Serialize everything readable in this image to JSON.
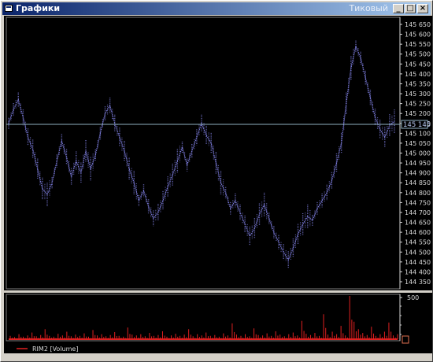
{
  "window": {
    "title": "Графики",
    "mode_label": "Тиковый",
    "controls": [
      "_",
      "□",
      "×"
    ]
  },
  "price_axis": {
    "ticks": [
      "145 650",
      "145 600",
      "145 550",
      "145 500",
      "145 450",
      "145 400",
      "145 350",
      "145 300",
      "145 250",
      "145 200",
      "145 150",
      "145 100",
      "145 050",
      "145 000",
      "144 950",
      "144 900",
      "144 850",
      "144 800",
      "144 750",
      "144 700",
      "144 650",
      "144 600",
      "144 550",
      "144 500",
      "144 450",
      "144 400",
      "144 350"
    ],
    "current_price_label": "145 145"
  },
  "volume_axis": {
    "tick_label": "500"
  },
  "legend": {
    "series_label": "RIM2 [Volume]"
  },
  "colors": {
    "price_series": "#7a7ad8",
    "current_line": "#8fb0c0",
    "volume_bars": "#e02020",
    "axis_text": "#d8d8d8",
    "background": "#000000"
  },
  "chart_data": [
    {
      "type": "line",
      "ylim": [
        144350,
        145650
      ],
      "y_ticks": [
        145650,
        145600,
        145550,
        145500,
        145450,
        145400,
        145350,
        145300,
        145250,
        145200,
        145150,
        145100,
        145050,
        145000,
        144950,
        144900,
        144850,
        144800,
        144750,
        144700,
        144650,
        144600,
        144550,
        144500,
        144450,
        144400,
        144350
      ],
      "reference_line": 145145,
      "series": [
        {
          "values": [
            145150,
            145220,
            145270,
            145180,
            145080,
            145020,
            144920,
            144820,
            144790,
            144850,
            144960,
            145060,
            144980,
            144880,
            144960,
            144900,
            145010,
            144920,
            144990,
            145100,
            145200,
            145240,
            145150,
            145080,
            145010,
            144920,
            144850,
            144760,
            144810,
            144730,
            144670,
            144700,
            144760,
            144830,
            144890,
            144960,
            145030,
            144940,
            145010,
            145080,
            145150,
            145090,
            145050,
            144950,
            144850,
            144800,
            144720,
            144760,
            144700,
            144640,
            144580,
            144620,
            144690,
            144740,
            144670,
            144600,
            144550,
            144500,
            144460,
            144520,
            144590,
            144640,
            144680,
            144660,
            144720,
            144760,
            144800,
            144860,
            144950,
            145050,
            145250,
            145430,
            145540,
            145480,
            145380,
            145280,
            145180,
            145120,
            145080,
            145140,
            145160
          ]
        }
      ]
    },
    {
      "type": "bar",
      "y_ticks": [
        500
      ],
      "series": [
        {
          "name": "RIM2 [Volume]",
          "values": [
            40,
            25,
            60,
            30,
            45,
            80,
            35,
            50,
            120,
            40,
            30,
            65,
            45,
            90,
            35,
            55,
            40,
            70,
            30,
            110,
            45,
            60,
            35,
            50,
            85,
            40,
            30,
            140,
            55,
            45,
            60,
            35,
            75,
            40,
            50,
            95,
            30,
            45,
            65,
            40,
            55,
            120,
            35,
            60,
            45,
            80,
            40,
            50,
            30,
            70,
            45,
            190,
            55,
            40,
            60,
            35,
            130,
            50,
            45,
            70,
            40,
            95,
            55,
            35,
            60,
            80,
            45,
            220,
            65,
            50,
            75,
            40,
            300,
            55,
            90,
            60,
            160,
            45,
            520,
            210,
            120,
            75,
            50,
            150,
            40,
            60,
            90,
            200,
            45,
            60
          ]
        }
      ]
    }
  ]
}
